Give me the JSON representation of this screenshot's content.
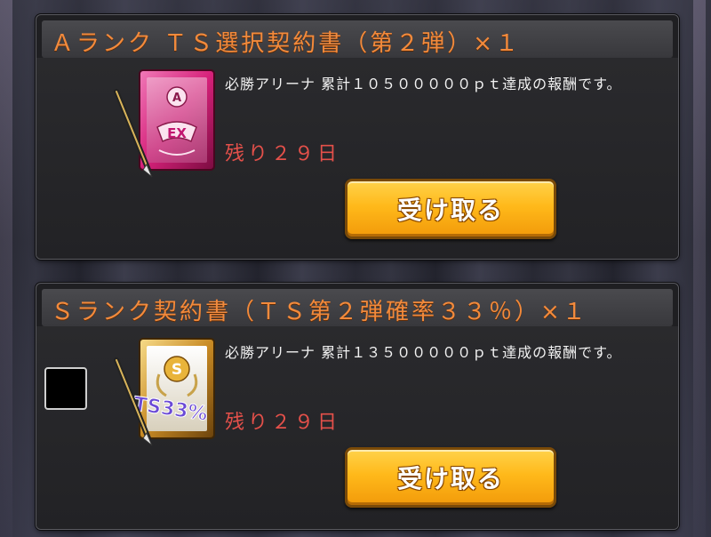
{
  "rewards": [
    {
      "title": "Ａランク ＴＳ選択契約書（第２弾）×１",
      "description": "必勝アリーナ 累計１０５０００００ｐｔ達成の報酬です。",
      "remaining": "残り２９日",
      "button_label": "受け取る",
      "icon": "a-rank-ts-select-contract-icon",
      "icon_letter": "A",
      "icon_badge": "EX",
      "accent_color": "#d6217a"
    },
    {
      "title": "Ｓランク契約書（ＴＳ第２弾確率３３％）×１",
      "description": "必勝アリーナ 累計１３５０００００ｐｔ達成の報酬です。",
      "remaining": "残り２９日",
      "button_label": "受け取る",
      "icon": "s-rank-contract-icon",
      "icon_letter": "S",
      "icon_badge": "TS33%",
      "accent_color": "#d9a236"
    }
  ],
  "colors": {
    "title": "#f28a3c",
    "remaining": "#e4504a",
    "button": "#ffb91a"
  }
}
